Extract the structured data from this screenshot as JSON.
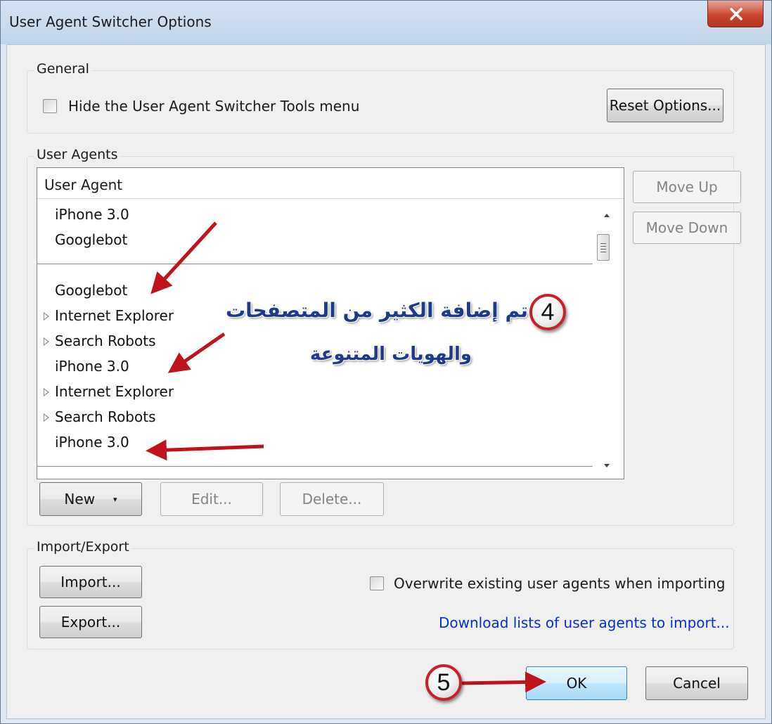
{
  "window": {
    "title": "User Agent Switcher Options"
  },
  "general": {
    "group_label": "General",
    "hide_tools_menu_label": "Hide the User Agent Switcher Tools menu",
    "hide_tools_menu_checked": false,
    "reset_button": "Reset Options..."
  },
  "user_agents": {
    "group_label": "User Agents",
    "column_header": "User Agent",
    "rows_top": [
      {
        "label": "iPhone 3.0"
      },
      {
        "label": "Googlebot"
      }
    ],
    "rows": [
      {
        "label": "Googlebot",
        "expandable": false
      },
      {
        "label": "Internet Explorer",
        "expandable": true
      },
      {
        "label": "Search Robots",
        "expandable": true
      },
      {
        "label": "iPhone 3.0",
        "expandable": false
      },
      {
        "label": "Internet Explorer",
        "expandable": true
      },
      {
        "label": "Search Robots",
        "expandable": true
      },
      {
        "label": "iPhone 3.0",
        "expandable": false
      }
    ],
    "move_up_button": "Move Up",
    "move_down_button": "Move Down",
    "new_button": "New",
    "edit_button": "Edit...",
    "delete_button": "Delete..."
  },
  "import_export": {
    "group_label": "Import/Export",
    "import_button": "Import...",
    "export_button": "Export...",
    "overwrite_label": "Overwrite existing user agents when importing",
    "overwrite_checked": false,
    "download_link": "Download lists of user agents to import..."
  },
  "footer": {
    "ok_button": "OK",
    "cancel_button": "Cancel"
  },
  "annotations": {
    "step4_number": "4",
    "step4_line1": "تم إضافة الكثير من المتصفحات",
    "step4_line2": "والهويات المتنوعة",
    "step5_number": "5"
  },
  "colors": {
    "arrow": "#c0141c",
    "link": "#0033cc",
    "annotation_text": "#1f3a8a"
  }
}
